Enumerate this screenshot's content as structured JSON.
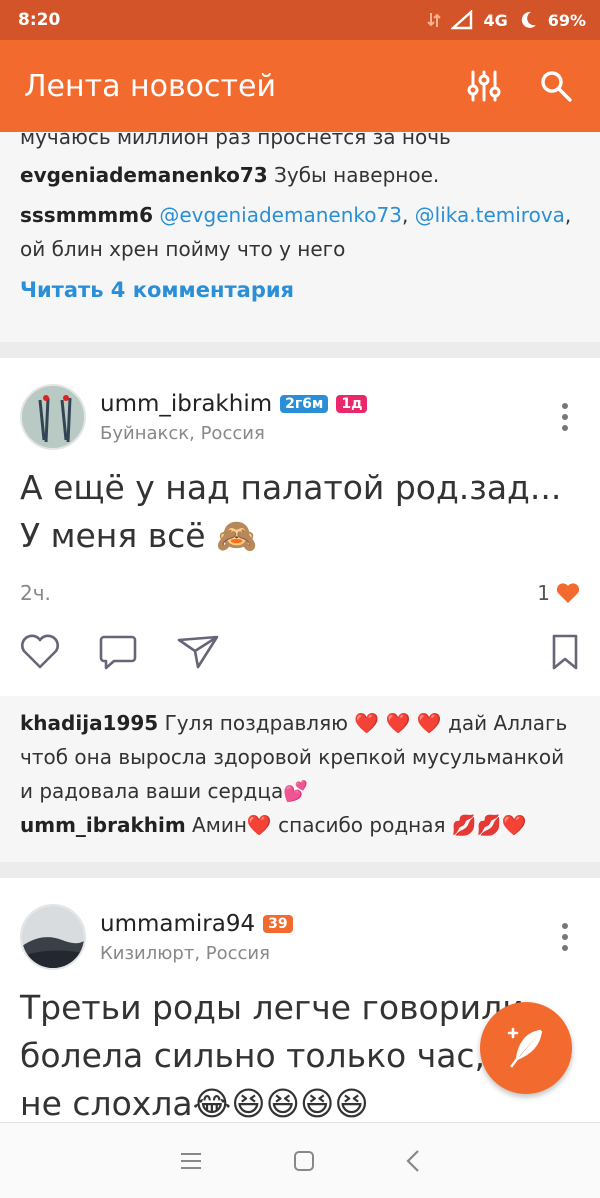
{
  "status_bar": {
    "time": "8:20",
    "network": "4G",
    "battery": "69%"
  },
  "app_bar": {
    "title": "Лента новостей"
  },
  "top_comments": {
    "partial_line": "мучаюсь миллион раз проснется за ночь",
    "comment1": {
      "user": "evgeniademanenko73",
      "text": "Зубы наверное."
    },
    "comment2": {
      "user": "sssmmmm6",
      "mention1": "@evgeniademanenko73",
      "sep": ",",
      "mention2": "@lika.temirova",
      "text": ", ой блин хрен пойму что у него"
    },
    "read_more": "Читать 4 комментария"
  },
  "post1": {
    "username": "umm_ibrakhim",
    "badge1": "2г6м",
    "badge2": "1д",
    "location": "Буйнакск, Россия",
    "text_line1": "А ещё у над палатой род.зад...",
    "text_line2": "У меня всё 🙈",
    "time": "2ч.",
    "likes": "1",
    "comments": [
      {
        "user": "khadija1995",
        "text": " Гуля поздравляю ❤️ ❤️ ❤️  дай Аллагь чтоб она выросла здоровой  крепкой мусульманкой и радовала ваши сердца💕"
      },
      {
        "user": "umm_ibrakhim",
        "text": " Амин❤️  спасибо родная 💋💋❤️"
      }
    ]
  },
  "post2": {
    "username": "ummamira94",
    "badge1": "39",
    "location": "Кизилюрт, Россия",
    "text_line1": "Третьи роды легче говорили",
    "text_line2": "болела сильно только час,а",
    "text_line3": "не слохла😂😆😆😆😆"
  },
  "colors": {
    "accent": "#f26a2e",
    "status": "#d4542a",
    "link": "#2a8fd6",
    "badge_blue": "#2a8fd6",
    "badge_pink": "#e8286b",
    "badge_orange": "#f26a2e",
    "heart": "#f26a2e"
  }
}
